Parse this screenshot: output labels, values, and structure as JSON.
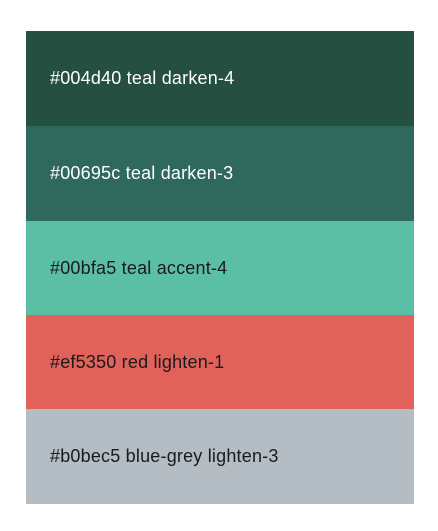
{
  "swatches": [
    {
      "label": "#004d40 teal darken-4",
      "bg": "#244f41",
      "text_color": "#ffffff"
    },
    {
      "label": "#00695c teal darken-3",
      "bg": "#2f685c",
      "text_color": "#ffffff"
    },
    {
      "label": "#00bfa5 teal accent-4",
      "bg": "#5bbfa6",
      "text_color": "#1a1a1a"
    },
    {
      "label": "#ef5350 red lighten-1",
      "bg": "#e0625a",
      "text_color": "#1a1a1a"
    },
    {
      "label": "#b0bec5 blue-grey lighten-3",
      "bg": "#b4bdc4",
      "text_color": "#1a1a1a"
    }
  ]
}
